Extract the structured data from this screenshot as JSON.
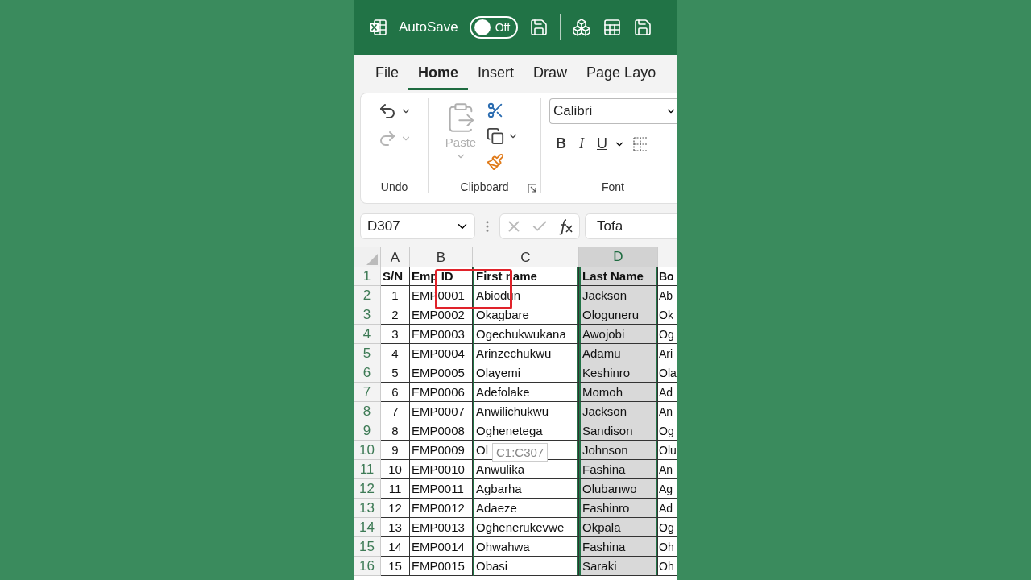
{
  "title_bar": {
    "autosave_label": "AutoSave",
    "autosave": {
      "on": false,
      "label": "Off"
    }
  },
  "tabs": [
    {
      "label": "File",
      "selected": false
    },
    {
      "label": "Home",
      "selected": true
    },
    {
      "label": "Insert",
      "selected": false
    },
    {
      "label": "Draw",
      "selected": false
    },
    {
      "label": "Page Layo",
      "selected": false
    }
  ],
  "ribbon": {
    "undo": {
      "label": "Undo",
      "redo_disabled": true
    },
    "clipboard": {
      "label": "Clipboard",
      "paste_label": "Paste",
      "paste_disabled": true
    },
    "font": {
      "label": "Font",
      "font_name": "Calibri",
      "bold": "B",
      "italic": "I",
      "underline": "U"
    }
  },
  "formula_bar": {
    "name_box": "D307",
    "formula": "Tofa"
  },
  "sheet": {
    "columns": [
      {
        "letter": "A",
        "selected": false,
        "outlined": false
      },
      {
        "letter": "B",
        "selected": false,
        "outlined": false
      },
      {
        "letter": "C",
        "selected": false,
        "outlined": true
      },
      {
        "letter": "D",
        "selected": true,
        "outlined": true
      },
      {
        "selected": false,
        "outlined": false
      }
    ],
    "rows": [
      {
        "number": "1",
        "kind": "header",
        "cells": [
          "S/N",
          "Emp ID",
          "First name",
          "Last Name",
          "Bo"
        ]
      },
      {
        "number": "2",
        "kind": "data",
        "cells": [
          "1",
          "EMP0001",
          "Abiodun",
          "Jackson",
          "Ab"
        ]
      },
      {
        "number": "3",
        "kind": "data",
        "cells": [
          "2",
          "EMP0002",
          "Okagbare",
          "Ologuneru",
          "Ok"
        ]
      },
      {
        "number": "4",
        "kind": "data",
        "cells": [
          "3",
          "EMP0003",
          "Ogechukwukana",
          "Awojobi",
          "Og"
        ]
      },
      {
        "number": "5",
        "kind": "data",
        "cells": [
          "4",
          "EMP0004",
          "Arinzechukwu",
          "Adamu",
          "Ari"
        ]
      },
      {
        "number": "6",
        "kind": "data",
        "cells": [
          "5",
          "EMP0005",
          "Olayemi",
          "Keshinro",
          "Ola"
        ]
      },
      {
        "number": "7",
        "kind": "data",
        "cells": [
          "6",
          "EMP0006",
          "Adefolake",
          "Momoh",
          "Ad"
        ]
      },
      {
        "number": "8",
        "kind": "data",
        "cells": [
          "7",
          "EMP0007",
          "Anwilichukwu",
          "Jackson",
          "An"
        ]
      },
      {
        "number": "9",
        "kind": "data",
        "cells": [
          "8",
          "EMP0008",
          "Oghenetega",
          "Sandison",
          "Og"
        ]
      },
      {
        "number": "10",
        "kind": "data",
        "cells": [
          "9",
          "EMP0009",
          "Ol",
          "Johnson",
          "Olu"
        ]
      },
      {
        "number": "11",
        "kind": "data",
        "cells": [
          "10",
          "EMP0010",
          "Anwulika",
          "Fashina",
          "An"
        ]
      },
      {
        "number": "12",
        "kind": "data",
        "cells": [
          "11",
          "EMP0011",
          "Agbarha",
          "Olubanwo",
          "Ag"
        ]
      },
      {
        "number": "13",
        "kind": "data",
        "cells": [
          "12",
          "EMP0012",
          "Adaeze",
          "Fashinro",
          "Ad"
        ]
      },
      {
        "number": "14",
        "kind": "data",
        "cells": [
          "13",
          "EMP0013",
          "Oghenerukevwe",
          "Okpala",
          "Og"
        ]
      },
      {
        "number": "15",
        "kind": "data",
        "cells": [
          "14",
          "EMP0014",
          "Ohwahwa",
          "Fashina",
          "Oh"
        ]
      },
      {
        "number": "16",
        "kind": "data",
        "cells": [
          "15",
          "EMP0015",
          "Obasi",
          "Saraki",
          "Oh"
        ]
      }
    ],
    "tooltip": "C1:C307"
  }
}
